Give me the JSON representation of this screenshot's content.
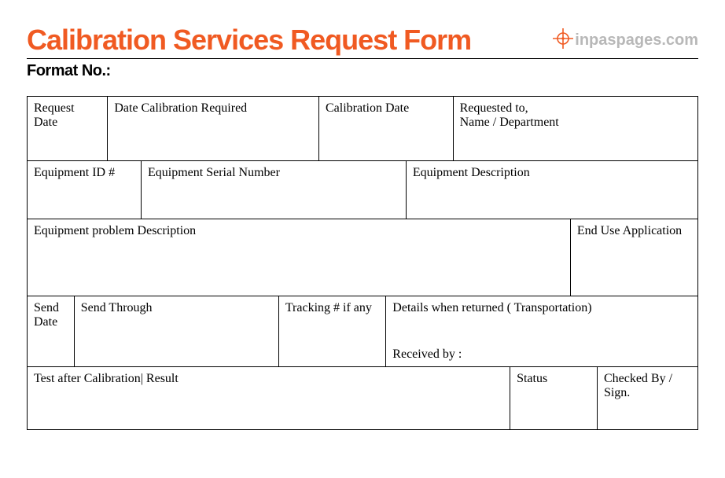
{
  "header": {
    "title": "Calibration Services Request Form",
    "brand": "inpaspages.com"
  },
  "format_no_label": "Format No.:",
  "cells": {
    "request_date": "Request Date",
    "date_cal_required": "Date Calibration Required",
    "calibration_date": "Calibration Date",
    "requested_to_l1": "Requested to,",
    "requested_to_l2": "Name / Department",
    "equipment_id": "Equipment ID #",
    "equipment_serial": "Equipment Serial Number",
    "equipment_desc": "Equipment Description",
    "problem_desc": "Equipment problem Description",
    "end_use": "End Use Application",
    "send_date": "Send Date",
    "send_through": "Send Through",
    "tracking": "Tracking # if any",
    "details_returned": "Details when returned ( Transportation)",
    "received_by": "Received by :",
    "test_result": "Test after Calibration| Result",
    "status": "Status",
    "checked_by": "Checked By / Sign."
  }
}
